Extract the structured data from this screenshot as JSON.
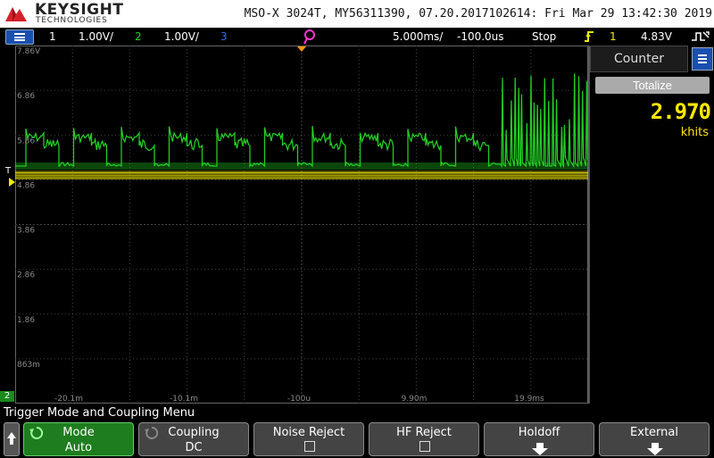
{
  "header": {
    "brand": "KEYSIGHT",
    "brand_sub": "TECHNOLOGIES",
    "instrument_info": "MSO-X 3024T, MY56311390, 07.20.2017102614: Fri Mar 29 13:42:30 2019"
  },
  "status": {
    "ch1_num": "1",
    "ch1_scale": "1.00V/",
    "ch2_num": "2",
    "ch2_scale": "1.00V/",
    "ch3_num": "3",
    "timebase": "5.000ms/",
    "delay": "-100.0us",
    "run_state": "Stop",
    "trigger_source": "1",
    "trigger_level": "4.83V",
    "colors": {
      "ch1": "#f0e800",
      "ch2": "#22cc22",
      "ch3": "#3366ff",
      "stop": "#ffffff"
    }
  },
  "graticule": {
    "y_labels": [
      "7.86V",
      "6.86",
      "5.86",
      "4.86",
      "3.86",
      "2.86",
      "1.86",
      "863m"
    ],
    "x_labels": [
      "-20.1m",
      "-10.1m",
      "-100u",
      "9.90m",
      "19.9ms"
    ],
    "ch2_marker": "2",
    "trigger_marker": "T"
  },
  "panel": {
    "title": "Counter",
    "totalize_label": "Totalize",
    "value": "2.970",
    "unit": "khits"
  },
  "softkeys": {
    "menu_title": "Trigger Mode and Coupling Menu",
    "mode": {
      "label": "Mode",
      "value": "Auto"
    },
    "coupling": {
      "label": "Coupling",
      "value": "DC"
    },
    "noise_reject": {
      "label": "Noise Reject"
    },
    "hf_reject": {
      "label": "HF Reject"
    },
    "holdoff": {
      "label": "Holdoff"
    },
    "external": {
      "label": "External"
    }
  }
}
